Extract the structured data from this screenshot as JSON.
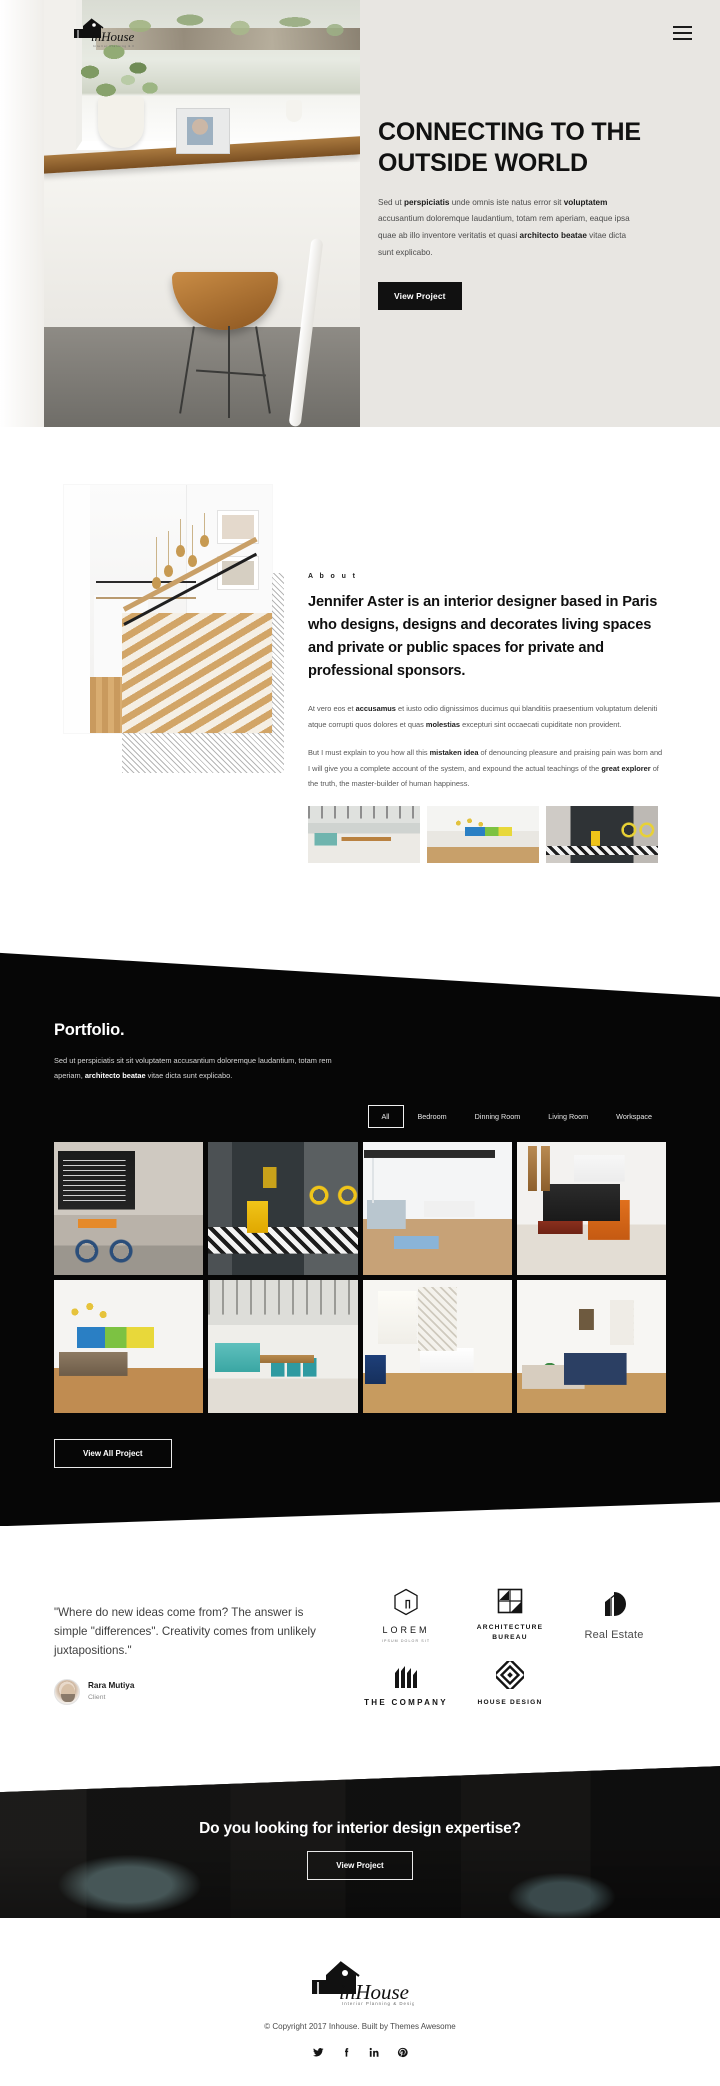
{
  "brand": {
    "name": "inHouse",
    "tagline": "Interior Planning & Design"
  },
  "nav": {
    "menu_icon": "hamburger-menu-icon"
  },
  "hero": {
    "title": "CONNECTING TO THE OUTSIDE WORLD",
    "description_html": "Sed ut <b>perspiciatis</b> unde omnis iste natus error sit <b>voluptatem</b> accusantium doloremque laudantium, totam rem aperiam, eaque ipsa quae ab illo inventore veritatis et quasi <b>architecto beatae</b> vitae dicta sunt explicabo.",
    "cta_label": "View Project"
  },
  "about": {
    "eyebrow": "A b o u t",
    "heading": "Jennifer Aster is an interior designer based in Paris who designs, designs and decorates living spaces and private or public spaces for private and professional sponsors.",
    "paragraph1_html": "At vero eos et <b>accusamus</b> et iusto odio dignissimos ducimus qui blanditiis praesentium voluptatum deleniti atque corrupti quos dolores et quas <b>molestias</b> excepturi sint occaecati cupiditate non provident.",
    "paragraph2_html": "But I must explain to you how all this <b>mistaken idea</b> of denouncing pleasure and praising pain was born and I will give you a complete account of the system, and expound the actual teachings of the <b>great explorer</b> of the truth, the master-builder of human happiness.",
    "thumbnails": [
      "loft-dining-room",
      "kitchen-bar-mural",
      "grey-workspace-bike"
    ]
  },
  "portfolio": {
    "title": "Portfolio.",
    "subtitle_html": "Sed ut perspiciatis  sit sit voluptatem accusantium doloremque laudantium, totam rem aperiam,  <b>architecto beatae</b> vitae dicta sunt explicabo.",
    "filters": [
      {
        "label": "All",
        "active": true
      },
      {
        "label": "Bedroom",
        "active": false
      },
      {
        "label": "Dinning Room",
        "active": false
      },
      {
        "label": "Living Room",
        "active": false
      },
      {
        "label": "Workspace",
        "active": false
      }
    ],
    "items": [
      {
        "name": "industrial-cafe-bikes"
      },
      {
        "name": "dark-wall-yellow-chair"
      },
      {
        "name": "white-loft-office"
      },
      {
        "name": "living-room-snowshoes"
      },
      {
        "name": "kitchen-bar-mural"
      },
      {
        "name": "loft-dining-teal"
      },
      {
        "name": "bright-room-plants"
      },
      {
        "name": "white-bedroom"
      }
    ],
    "cta_label": "View All Project"
  },
  "testimonial": {
    "quote": "\"Where do new ideas come from? The answer is simple \"differences\". Creativity comes from unlikely juxtapositions.\"",
    "author": "Rara Mutiya",
    "role": "Client",
    "avatar": "client-avatar"
  },
  "clients": [
    {
      "name": "LOREM",
      "sub": "IPSUM DOLOR SIT",
      "icon": "hexagon-house-icon",
      "style": "wordmark-sub"
    },
    {
      "name": "ARCHITECTURE BUREAU",
      "icon": "square-split-icon",
      "style": "two-line"
    },
    {
      "name": "Real Estate",
      "icon": "building-circle-icon",
      "style": "inline"
    },
    {
      "name": "THE COMPANY",
      "icon": "skyline-bars-icon",
      "style": "wordmark"
    },
    {
      "name": "HOUSE DESIGN",
      "icon": "diamond-maze-icon",
      "style": "wordmark-bold"
    }
  ],
  "cta": {
    "title": "Do you looking for interior design expertise?",
    "button_label": "View Project"
  },
  "footer": {
    "copyright": "© Copyright 2017 Inhouse. Built by Themes Awesome",
    "socials": [
      {
        "name": "twitter-icon",
        "glyph": "🐦"
      },
      {
        "name": "facebook-icon",
        "glyph": "f"
      },
      {
        "name": "linkedin-icon",
        "glyph": "in"
      },
      {
        "name": "pinterest-icon",
        "glyph": "P"
      }
    ]
  },
  "colors": {
    "ink": "#0b0b0b",
    "dark_section": "#060606",
    "muted": "#585858",
    "page_bg": "#ffffff"
  }
}
